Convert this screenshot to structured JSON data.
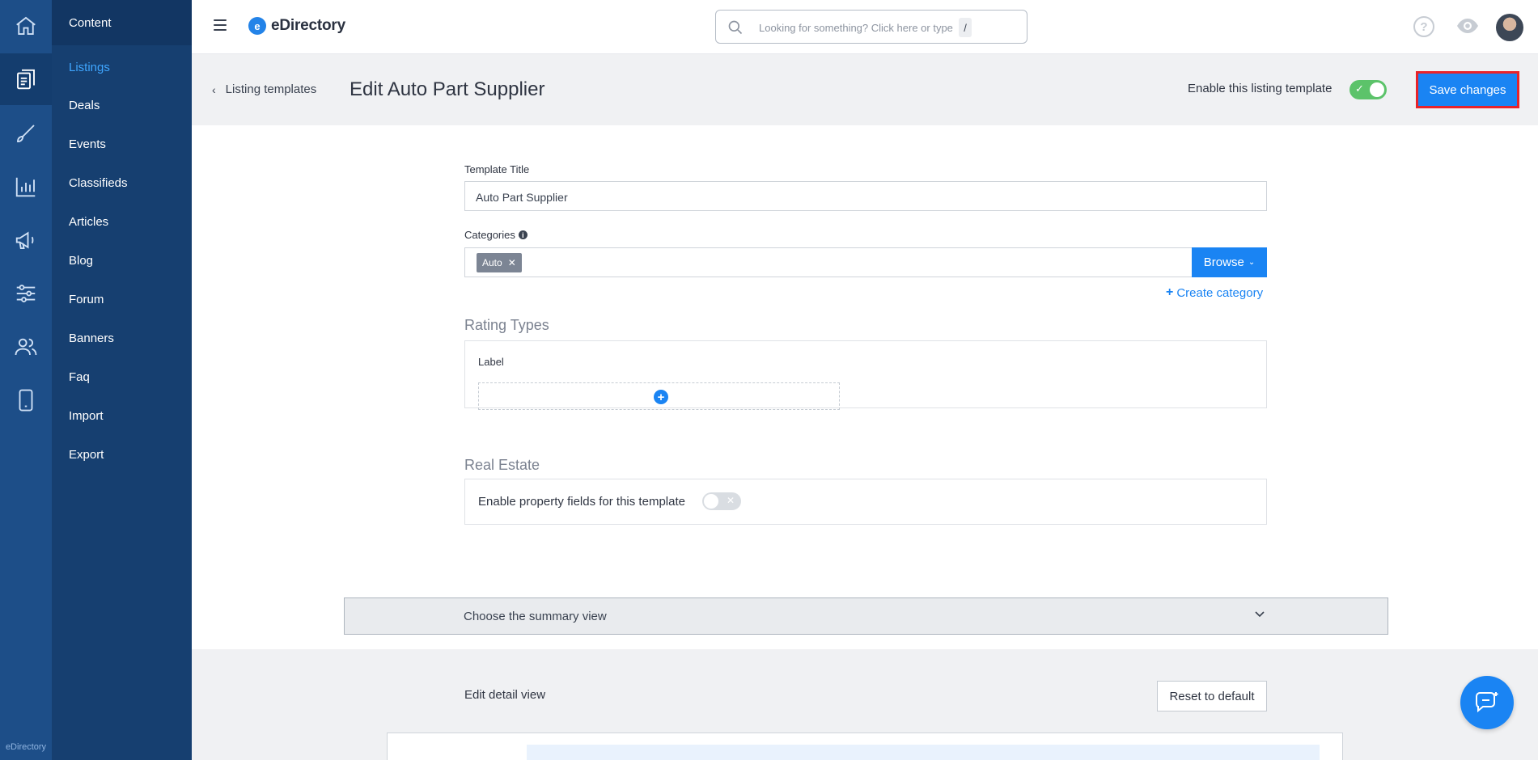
{
  "rail": {
    "items": [
      "home-icon",
      "content-icon",
      "design-icon",
      "reports-icon",
      "promote-icon",
      "settings-icon",
      "users-icon",
      "mobile-icon"
    ],
    "active_index": 1,
    "brand_label": "eDirectory"
  },
  "subnav": {
    "header": "Content",
    "items": [
      "Listings",
      "Deals",
      "Events",
      "Classifieds",
      "Articles",
      "Blog",
      "Forum",
      "Banners",
      "Faq",
      "Import",
      "Export"
    ],
    "active_index": 0
  },
  "topbar": {
    "logo_letter": "e",
    "logo_text": "eDirectory",
    "search_placeholder": "Looking for something? Click here or type",
    "search_shortcut": "/",
    "help_glyph": "?"
  },
  "header": {
    "back_label": "Listing templates",
    "title": "Edit Auto Part Supplier",
    "enable_label": "Enable this listing template",
    "enable_on": true,
    "save_label": "Save changes"
  },
  "form": {
    "template_title_label": "Template Title",
    "template_title_value": "Auto Part Supplier",
    "categories_label": "Categories",
    "category_chips": [
      "Auto"
    ],
    "browse_label": "Browse",
    "create_category_label": "Create category",
    "rating_types_title": "Rating Types",
    "rating_label": "Label",
    "real_estate_title": "Real Estate",
    "property_fields_label": "Enable property fields for this template",
    "property_fields_on": false,
    "summary_view_label": "Choose the summary view"
  },
  "detail": {
    "edit_detail_label": "Edit detail view",
    "reset_label": "Reset to default"
  },
  "colors": {
    "rail": "#1d4e88",
    "subnav": "#163f70",
    "accent": "#1a84f3",
    "toggle_on": "#5cc36a",
    "highlight_border": "#e8232a"
  }
}
